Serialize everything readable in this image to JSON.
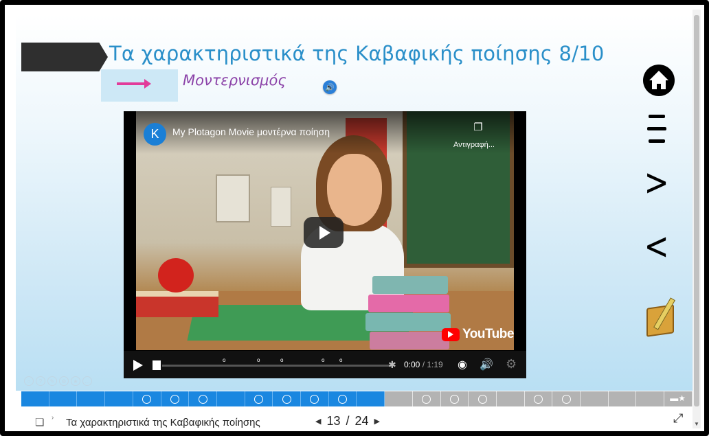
{
  "slide": {
    "title": "Τα χαρακτηριστικά της Καβαφικής ποίησης 8/10",
    "subtitle": "Μοντερνισμός",
    "audio_icon": "speaker-icon"
  },
  "video": {
    "channel_initial": "K",
    "title": "My Plotagon Movie μοντέρνα ποίηση",
    "copy_label": "Αντιγραφή...",
    "brand": "YouTube",
    "current_time": "0:00",
    "duration": " / 1:19",
    "colors": {
      "brand_red": "#ff0000",
      "controls_bg": "#111111"
    }
  },
  "side_nav": {
    "icons": [
      "home-icon",
      "menu-icon",
      "next-arrow-icon",
      "prev-arrow-icon",
      "notes-icon"
    ]
  },
  "progress_bar": {
    "total_segments": 24,
    "completed_segments": 13,
    "colors": {
      "done": "#1a87e0",
      "pending": "#b3b3b3"
    }
  },
  "footer": {
    "toc_title": "Τα χαρακτηριστικά της Καβαφικής ποίησης",
    "current_page": "13",
    "separator": "/",
    "total_pages": "24"
  },
  "colors": {
    "title": "#2a8fc9",
    "subtitle": "#8b42a8",
    "arrow": "#e23b9a"
  }
}
